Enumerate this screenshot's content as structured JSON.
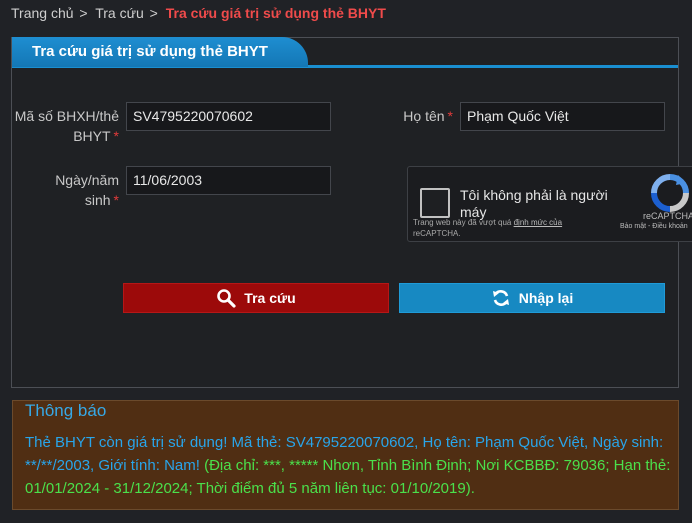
{
  "breadcrumb": {
    "home": "Trang chủ",
    "sep": ">",
    "lookup": "Tra cứu",
    "current": "Tra cứu giá trị sử dụng thẻ BHYT"
  },
  "panel": {
    "title": "Tra cứu giá trị sử dụng thẻ BHYT"
  },
  "form": {
    "code_label_line1": "Mã số BHXH/thẻ",
    "code_label_line2": "BHYT",
    "code_value": "SV4795220070602",
    "name_label": "Họ tên",
    "name_value": "Phạm Quốc Việt",
    "dob_label_line1": "Ngày/năm",
    "dob_label_line2": "sinh",
    "dob_value": "11/06/2003",
    "required_mark": "*"
  },
  "captcha": {
    "label": "Tôi không phải là người máy",
    "brand": "reCAPTCHA",
    "links": "Bảo mật - Điều khoản",
    "note_prefix": "Trang web này đã vượt quá",
    "note_link": "định mức của",
    "note_suffix": "reCAPTCHA."
  },
  "buttons": {
    "search": "Tra cứu",
    "reset": "Nhập lại"
  },
  "notice": {
    "title": "Thông báo",
    "text_blue": "Thẻ BHYT còn giá trị sử dụng! Mã thẻ: SV4795220070602, Họ tên: Phạm Quốc Việt, Ngày sinh: **/**/2003, Giới tính: Nam! ",
    "text_green": "(Địa chỉ: ***, ***** Nhơn, Tỉnh Bình Định; Nơi KCBBĐ: 79036; Hạn thẻ: 01/01/2024 - 31/12/2024; Thời điểm đủ 5 năm liên tục: 01/10/2019)."
  },
  "colors": {
    "background": "#202226",
    "accent": "#1a8fd0",
    "search_button": "#9c0a0a",
    "reset_button": "#1789c2",
    "notice_bg": "#502e13",
    "notice_text": "#29a5ea",
    "notice_highlight": "#4be04b"
  },
  "icons": {
    "search": "magnifier-icon",
    "reset": "refresh-icon",
    "captcha": "recaptcha-logo-icon"
  }
}
